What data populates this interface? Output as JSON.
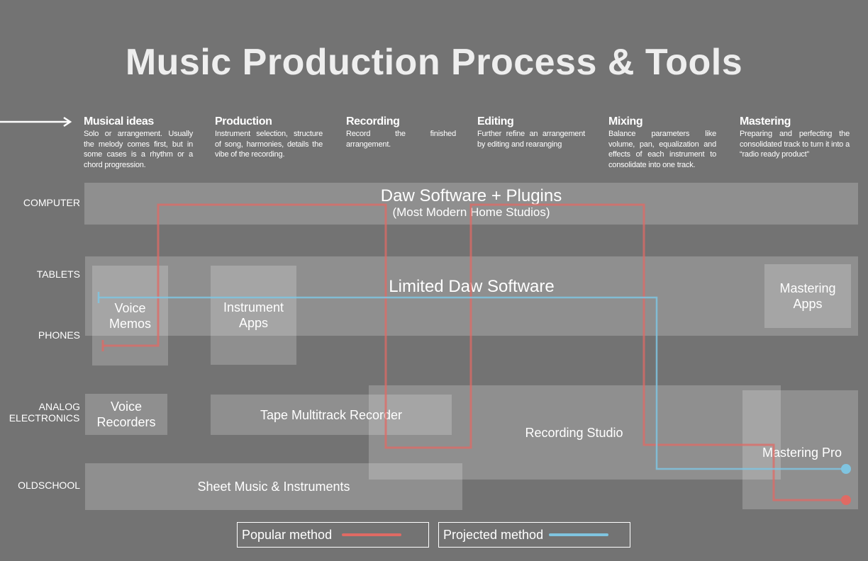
{
  "title": "Music Production Process & Tools",
  "stages": [
    {
      "name": "Musical ideas",
      "description": "Solo or arrangement. Usually the melody comes first, but in some cases is a rhythm or a chord progression."
    },
    {
      "name": "Production",
      "description": "Instrument selection, structure of song, harmonies, details the vibe of the recording."
    },
    {
      "name": "Recording",
      "description": "Record the finished arrangement."
    },
    {
      "name": "Editing",
      "description": "Further refine an arrangement by editing and rearanging"
    },
    {
      "name": "Mixing",
      "description": "Balance parameters like volume, pan, equalization and effects of each instrument to consolidate into one track."
    },
    {
      "name": "Mastering",
      "description": "Preparing and perfecting the consolidated track to turn it into a “radio ready product”"
    }
  ],
  "rows": {
    "computer": "COMPUTER",
    "tablets": "TABLETS",
    "phones": "PHONES",
    "analog_line1": "ANALOG",
    "analog_line2": "ELECTRONICS",
    "oldschool": "OLDSCHOOL"
  },
  "boxes": {
    "daw": "Daw Software + Plugins",
    "daw_sub": "(Most Modern Home Studios)",
    "limited_daw": "Limited Daw Software",
    "voice_memos_1": "Voice",
    "voice_memos_2": "Memos",
    "instrument_apps_1": "Instrument",
    "instrument_apps_2": "Apps",
    "mastering_apps_1": "Mastering",
    "mastering_apps_2": "Apps",
    "voice_recorders_1": "Voice",
    "voice_recorders_2": "Recorders",
    "tape": "Tape Multitrack Recorder",
    "recording_studio": "Recording Studio",
    "mastering_pro": "Mastering Pro",
    "sheet_music": "Sheet Music & Instruments"
  },
  "legend": {
    "popular": "Popular method",
    "projected": "Projected method"
  },
  "colors": {
    "background": "#737373",
    "popular": "#e06a64",
    "projected": "#7fc4e0"
  }
}
